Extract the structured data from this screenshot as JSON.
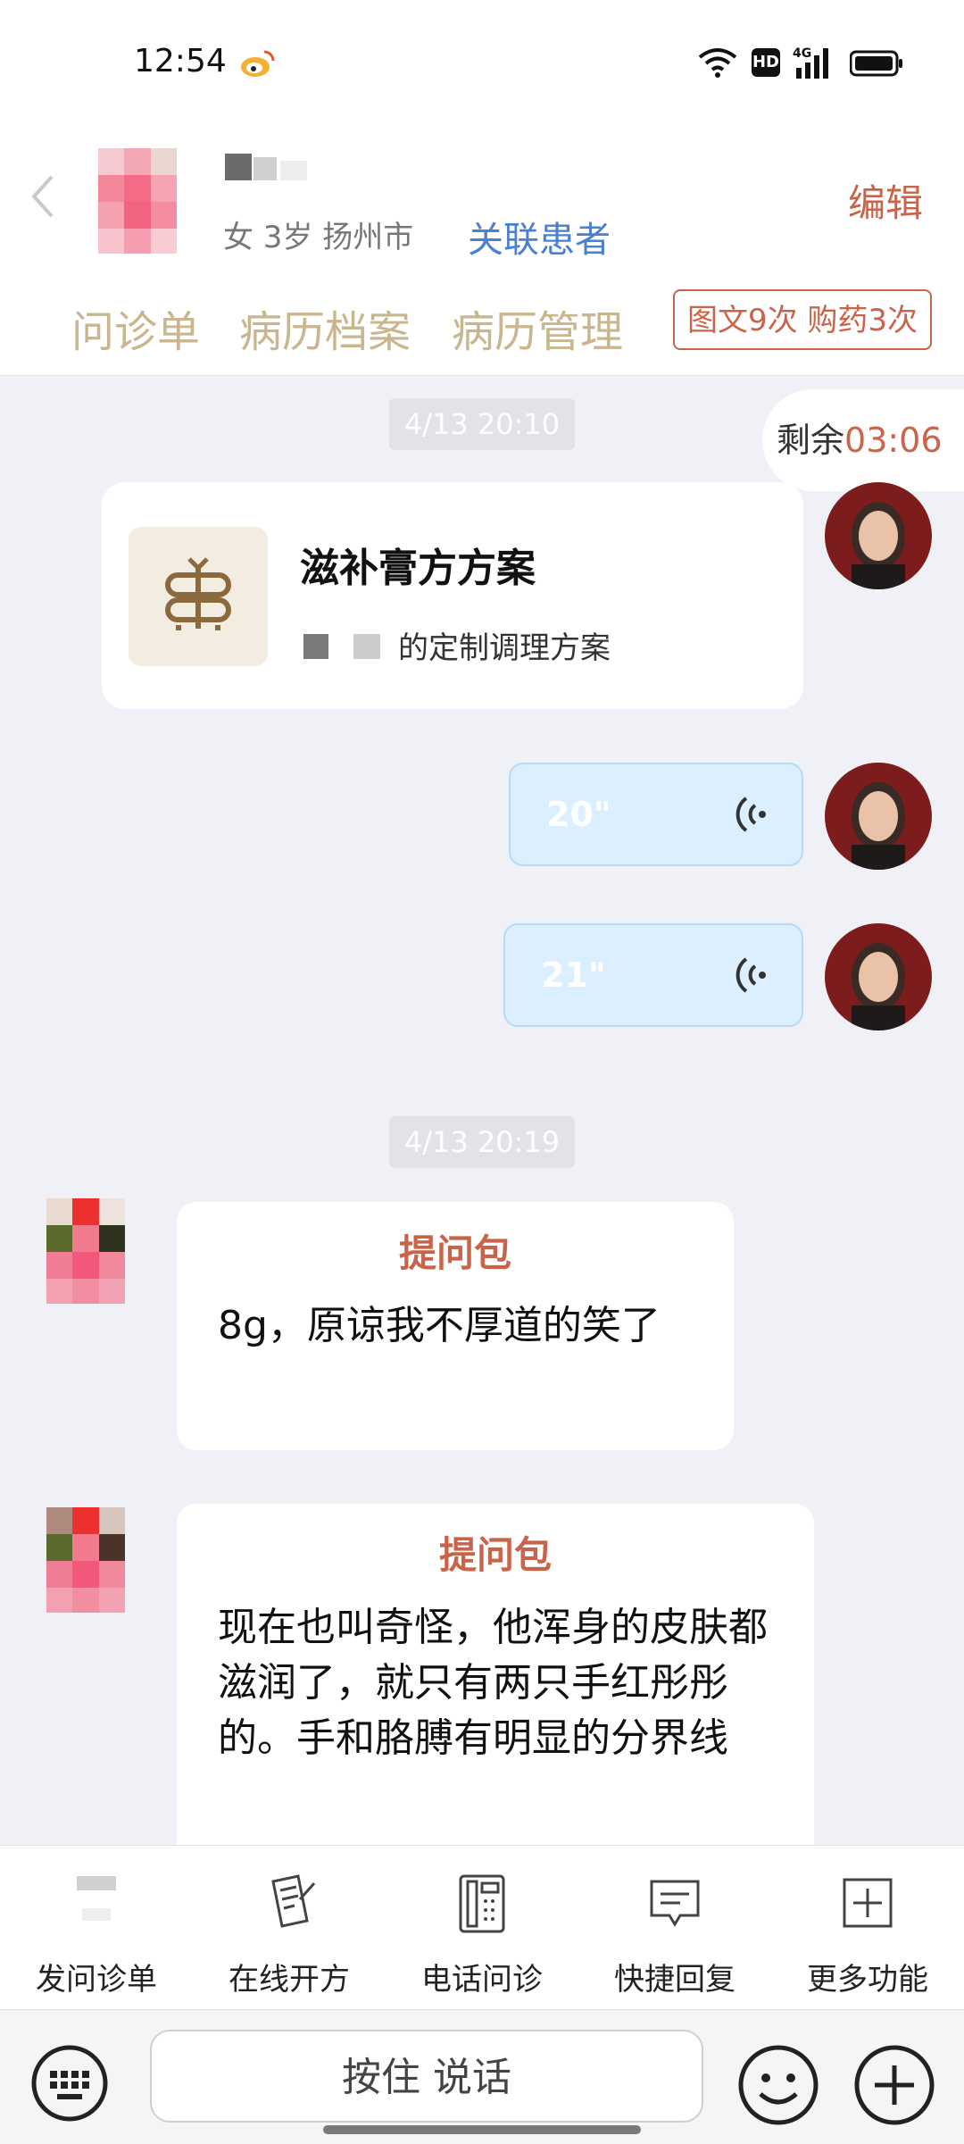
{
  "status_bar": {
    "time": "12:54",
    "network": "4G",
    "hd_label": "HD"
  },
  "header": {
    "patient_info": "女 3岁  扬州市",
    "link_patient": "关联患者",
    "edit": "编辑",
    "tabs": [
      {
        "label": "问诊单"
      },
      {
        "label": "病历档案"
      },
      {
        "label": "病历管理"
      }
    ],
    "service_badge": "图文9次 购药3次"
  },
  "chat": {
    "time_1": "4/13 20:10",
    "remaining_label": "剩余",
    "remaining_time": "03:06",
    "plan_card": {
      "title": "滋补膏方方案",
      "subtitle": "的定制调理方案"
    },
    "voice_messages": [
      {
        "duration": "20\""
      },
      {
        "duration": "21\""
      }
    ],
    "time_2": "4/13 20:19",
    "questions": [
      {
        "title": "提问包",
        "text": "8g，原谅我不厚道的笑了"
      },
      {
        "title": "提问包",
        "text": "现在也叫奇怪，他浑身的皮肤都滋润了，就只有两只手红彤彤的。手和胳膊有明显的分界线"
      }
    ]
  },
  "toolbar": {
    "items": [
      {
        "label": "发问诊单",
        "icon": "form-icon"
      },
      {
        "label": "在线开方",
        "icon": "prescription-icon"
      },
      {
        "label": "电话问诊",
        "icon": "phone-icon"
      },
      {
        "label": "快捷回复",
        "icon": "quick-reply-icon"
      },
      {
        "label": "更多功能",
        "icon": "plus-square-icon"
      }
    ]
  },
  "input_bar": {
    "hold_to_talk": "按住 说话"
  },
  "colors": {
    "accent": "#c9644a",
    "link": "#4a7fd6",
    "tab_text": "#c9b68e",
    "voice_bubble": "#dcefff",
    "chat_bg": "#f0f1f6"
  }
}
